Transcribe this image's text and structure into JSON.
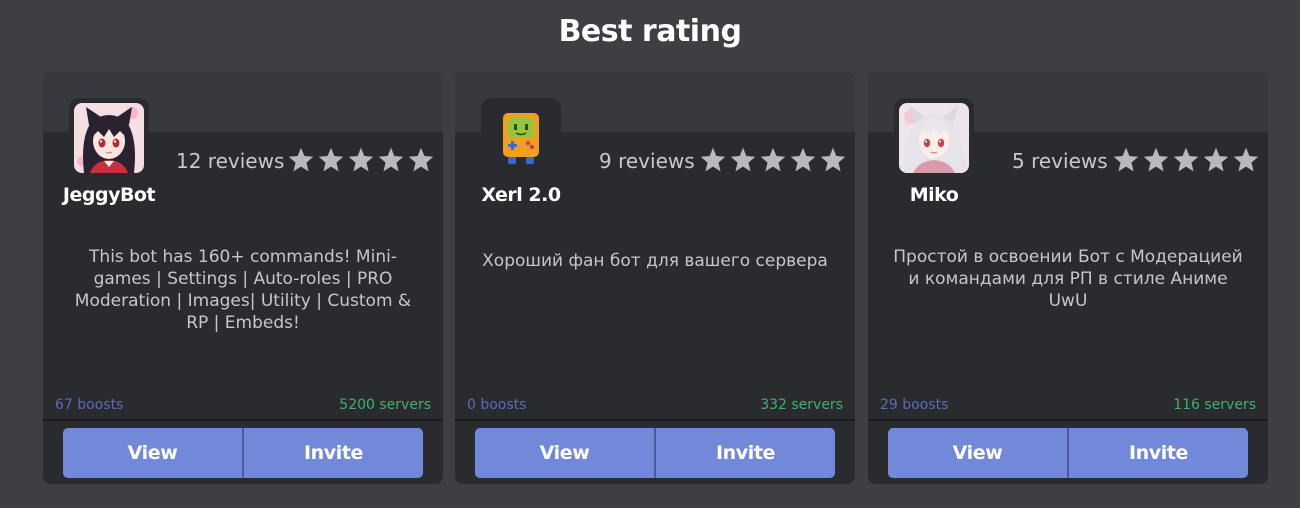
{
  "section": {
    "title": "Best rating"
  },
  "cards": [
    {
      "name": "JeggyBot",
      "reviews": "12 reviews",
      "rating": 5,
      "description": "This bot has 160+ commands! Mini-games | Settings | Auto-roles | PRO Moderation | Images| Utility | Custom & RP | Embeds!",
      "boosts": "67 boosts",
      "servers": "5200 servers",
      "view_label": "View",
      "invite_label": "Invite",
      "avatar": "anime-girl-black-hair-avatar"
    },
    {
      "name": "Xerl 2.0",
      "reviews": "9 reviews",
      "rating": 5,
      "description": "Хороший фан бот для вашего сервера",
      "boosts": "0 boosts",
      "servers": "332 servers",
      "view_label": "View",
      "invite_label": "Invite",
      "avatar": "game-console-avatar"
    },
    {
      "name": "Miko",
      "reviews": "5 reviews",
      "rating": 5,
      "description": "Простой в освоении Бот с Модерацией и командами для РП в стиле Аниме UwU",
      "boosts": "29 boosts",
      "servers": "116 servers",
      "view_label": "View",
      "invite_label": "Invite",
      "avatar": "anime-girl-white-hair-avatar"
    }
  ],
  "colors": {
    "background": "#3f3e43",
    "card": "#2a2b2f",
    "banner": "#37393f",
    "button": "#7289da",
    "boosts": "#5c6ab8",
    "servers": "#3fb26a",
    "star": "#b9b9bc"
  }
}
